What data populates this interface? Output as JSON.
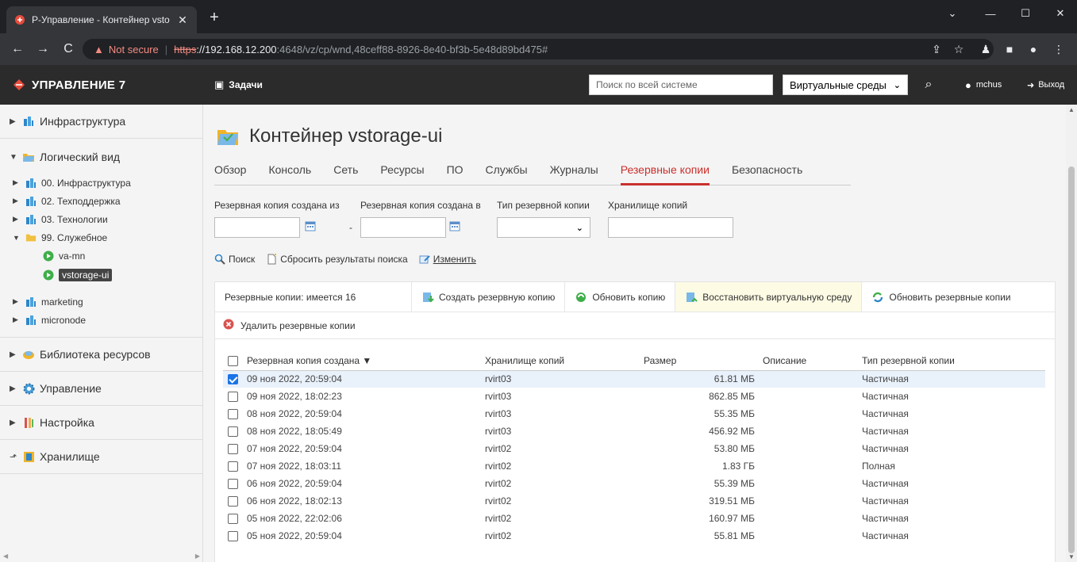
{
  "browser": {
    "tab_title": "Р-Управление - Контейнер vsto",
    "url_warning": "Not secure",
    "url_scheme": "https",
    "url_host": "://192.168.12.200",
    "url_path": ":4648/vz/cp/wnd,48ceff88-8926-8e40-bf3b-5e48d89bd475#"
  },
  "header": {
    "brand": "УПРАВЛЕНИЕ 7",
    "tasks": "Задачи",
    "search_placeholder": "Поиск по всей системе",
    "scope": "Виртуальные среды",
    "user": "mchus",
    "logout": "Выход"
  },
  "sidebar": {
    "infrastructure": "Инфраструктура",
    "logical_view": "Логический вид",
    "items": [
      {
        "label": "00. Инфраструктура"
      },
      {
        "label": "02. Техподдержка"
      },
      {
        "label": "03. Технологии"
      },
      {
        "label": "99. Служебное"
      }
    ],
    "vms": [
      {
        "label": "va-mn"
      },
      {
        "label": "vstorage-ui"
      }
    ],
    "groups": [
      {
        "label": "marketing"
      },
      {
        "label": "micronode"
      }
    ],
    "resource_library": "Библиотека ресурсов",
    "management": "Управление",
    "settings": "Настройка",
    "storage": "Хранилище"
  },
  "main": {
    "title": "Контейнер vstorage-ui",
    "tabs": [
      "Обзор",
      "Консоль",
      "Сеть",
      "Ресурсы",
      "ПО",
      "Службы",
      "Журналы",
      "Резервные копии",
      "Безопасность"
    ],
    "active_tab": "Резервные копии"
  },
  "filters": {
    "from_label": "Резервная копия создана из",
    "to_label": "Резервная копия создана в",
    "type_label": "Тип резервной копии",
    "storage_label": "Хранилище копий",
    "dash": "-"
  },
  "actions": {
    "search": "Поиск",
    "reset": "Сбросить результаты поиска",
    "change": "Изменить"
  },
  "backups": {
    "count_label": "Резервные копии: имеется 16",
    "create": "Создать резервную копию",
    "update_copy": "Обновить копию",
    "restore": "Восстановить виртуальную среду",
    "refresh": "Обновить резервные копии",
    "delete": "Удалить резервные копии",
    "columns": {
      "created": "Резервная копия создана ▼",
      "storage": "Хранилище копий",
      "size": "Размер",
      "description": "Описание",
      "type": "Тип резервной копии"
    },
    "rows": [
      {
        "created": "09 ноя 2022, 20:59:04",
        "storage": "rvirt03",
        "size": "61.81 МБ",
        "desc": "",
        "type": "Частичная",
        "checked": true
      },
      {
        "created": "09 ноя 2022, 18:02:23",
        "storage": "rvirt03",
        "size": "862.85 МБ",
        "desc": "",
        "type": "Частичная",
        "checked": false
      },
      {
        "created": "08 ноя 2022, 20:59:04",
        "storage": "rvirt03",
        "size": "55.35 МБ",
        "desc": "",
        "type": "Частичная",
        "checked": false
      },
      {
        "created": "08 ноя 2022, 18:05:49",
        "storage": "rvirt03",
        "size": "456.92 МБ",
        "desc": "",
        "type": "Частичная",
        "checked": false
      },
      {
        "created": "07 ноя 2022, 20:59:04",
        "storage": "rvirt02",
        "size": "53.80 МБ",
        "desc": "",
        "type": "Частичная",
        "checked": false
      },
      {
        "created": "07 ноя 2022, 18:03:11",
        "storage": "rvirt02",
        "size": "1.83 ГБ",
        "desc": "",
        "type": "Полная",
        "checked": false
      },
      {
        "created": "06 ноя 2022, 20:59:04",
        "storage": "rvirt02",
        "size": "55.39 МБ",
        "desc": "",
        "type": "Частичная",
        "checked": false
      },
      {
        "created": "06 ноя 2022, 18:02:13",
        "storage": "rvirt02",
        "size": "319.51 МБ",
        "desc": "",
        "type": "Частичная",
        "checked": false
      },
      {
        "created": "05 ноя 2022, 22:02:06",
        "storage": "rvirt02",
        "size": "160.97 МБ",
        "desc": "",
        "type": "Частичная",
        "checked": false
      },
      {
        "created": "05 ноя 2022, 20:59:04",
        "storage": "rvirt02",
        "size": "55.81 МБ",
        "desc": "",
        "type": "Частичная",
        "checked": false
      }
    ]
  },
  "colors": {
    "accent": "#c9302c",
    "header_bg": "#2b2b2b",
    "selected_row": "#e9f1fb",
    "highlight_button": "#fdfbe4"
  }
}
